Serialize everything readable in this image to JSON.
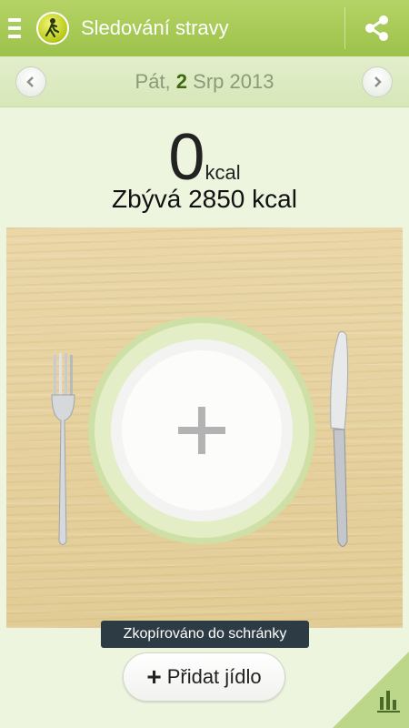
{
  "app": {
    "title": "Sledování stravy"
  },
  "date": {
    "weekday": "Pát,",
    "day": "2",
    "month_year": "Srp 2013"
  },
  "calories": {
    "value": "0",
    "unit": "kcal",
    "remaining": "Zbývá 2850 kcal"
  },
  "toast": {
    "text": "Zkopírováno do schránky"
  },
  "add_meal": {
    "plus": "+",
    "label": "Přidat jídlo"
  },
  "icons": {
    "drawer": "drawer-icon",
    "logo": "app-logo",
    "share": "share-icon",
    "prev": "chevron-left-icon",
    "next": "chevron-right-icon",
    "add_food": "plus-icon",
    "stats": "bar-chart-icon"
  },
  "colors": {
    "accent": "#9cc24a",
    "date_bar": "#dceabe",
    "background": "#eef5df",
    "toast": "#2d3b45",
    "date_day": "#3d6a10"
  }
}
